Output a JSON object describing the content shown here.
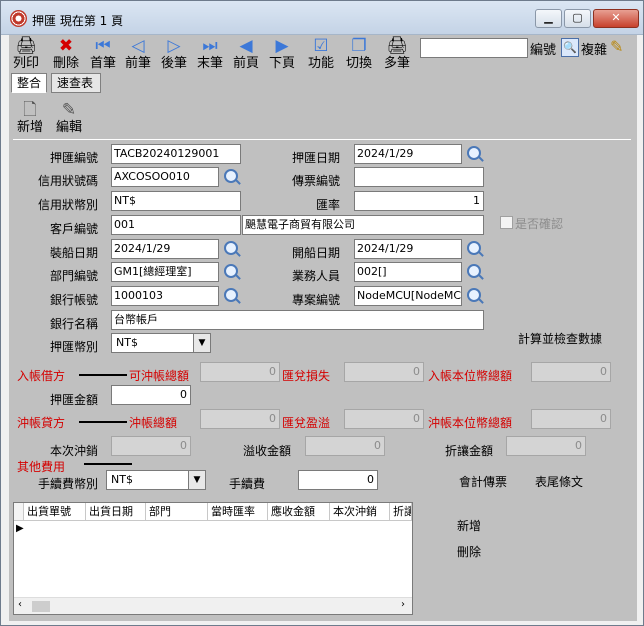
{
  "window": {
    "title": "押匯  現在第 1 頁",
    "min": "▁",
    "max": "▢",
    "close": "✕"
  },
  "toolbar": {
    "items": [
      {
        "label": "列印",
        "icon": "🖨"
      },
      {
        "label": "刪除",
        "icon": "✖"
      },
      {
        "label": "首筆",
        "icon": "⏮"
      },
      {
        "label": "前筆",
        "icon": "◁"
      },
      {
        "label": "後筆",
        "icon": "▷"
      },
      {
        "label": "末筆",
        "icon": "⏭"
      },
      {
        "label": "前頁",
        "icon": "◀"
      },
      {
        "label": "下頁",
        "icon": "▶"
      },
      {
        "label": "功能",
        "icon": "☑"
      },
      {
        "label": "切換",
        "icon": "❐"
      },
      {
        "label": "多筆",
        "icon": "🖨"
      }
    ],
    "search_value": "",
    "code_label": "編號",
    "copy_label": "複雜"
  },
  "tabs": [
    "整合",
    "速查表"
  ],
  "subtoolbar": {
    "new_label": "新增",
    "edit_label": "編輯"
  },
  "form": {
    "remit_no_label": "押匯編號",
    "remit_no": "TACB20240129001",
    "remit_date_label": "押匯日期",
    "remit_date": "2024/1/29",
    "lc_no_label": "信用狀號碼",
    "lc_no": "AXCOSOO010",
    "voucher_label": "傳票編號",
    "voucher": "",
    "lc_currency_label": "信用狀幣別",
    "lc_currency": "NT$",
    "rate_label": "匯率",
    "rate": "1",
    "customer_label": "客戶編號",
    "customer_code": "001",
    "customer_name": "颶慧電子商貿有限公司",
    "confirmed_label": "是否確認",
    "ship_date_label": "裝船日期",
    "ship_date": "2024/1/29",
    "sail_date_label": "開船日期",
    "sail_date": "2024/1/29",
    "dept_label": "部門編號",
    "dept": "GM1[總經理室]",
    "staff_label": "業務人員",
    "staff": "002[]",
    "bank_acct_label": "銀行帳號",
    "bank_acct": "1000103",
    "project_label": "專案編號",
    "project": "NodeMCU[NodeMCU專",
    "bank_name_label": "銀行名稱",
    "bank_name": "台幣帳戶",
    "remit_currency_label": "押匯幣別",
    "remit_currency": "NT$",
    "calc_label": "計算並檢查數據",
    "debit_label": "入帳借方",
    "offset_total_label": "可沖帳總額",
    "offset_total": "0",
    "fx_loss_label": "匯兌損失",
    "fx_loss": "0",
    "local_total_label": "入帳本位幣總額",
    "local_total": "0",
    "remit_amount_label": "押匯金額",
    "remit_amount": "0",
    "credit_label": "沖帳貸方",
    "credit_total_label": "沖帳總額",
    "credit_total": "0",
    "fx_gain_label": "匯兌盈溢",
    "fx_gain": "0",
    "credit_local_label": "沖帳本位幣總額",
    "credit_local": "0",
    "this_offset_label": "本次沖銷",
    "this_offset": "0",
    "over_label": "溢收金額",
    "over": "0",
    "discount_label": "折讓金額",
    "discount": "0",
    "other_fee_label": "其他費用",
    "fee_currency_label": "手續費幣別",
    "fee_currency": "NT$",
    "fee_label": "手續費",
    "fee": "0",
    "acct_voucher_label": "會計傳票",
    "footer_text_label": "表尾條文"
  },
  "grid": {
    "columns": [
      "出貨單號",
      "出貨日期",
      "部門",
      "當時匯率",
      "應收金額",
      "本次沖銷",
      "折讓"
    ],
    "add_label": "新增",
    "delete_label": "刪除"
  }
}
